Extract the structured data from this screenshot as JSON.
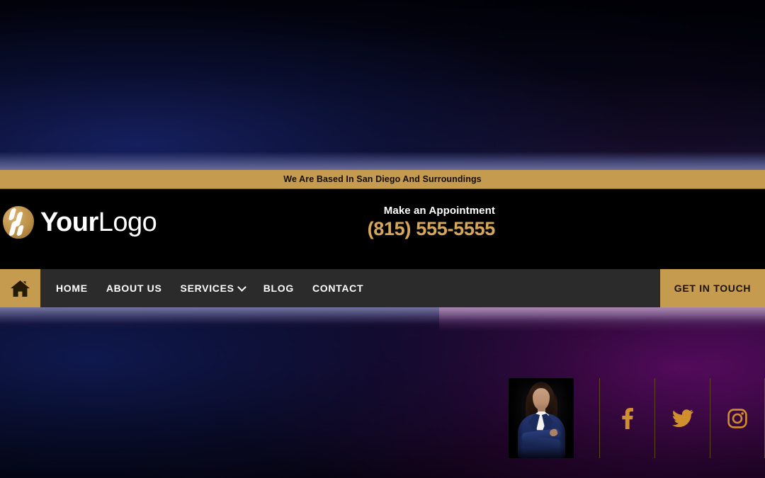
{
  "colors": {
    "gold": "#c59b50",
    "gold_text": "#d7a759",
    "nav_bg": "#2b2b2b",
    "header_bg": "#000000",
    "announce_text": "#140d02",
    "nav_text": "#ffffff",
    "cta_text": "#1a1206",
    "divider": "#5c4620"
  },
  "announcement": {
    "text": "We Are Based In San Diego And Surroundings"
  },
  "header": {
    "logo": {
      "icon": "shield-stripes-logo-icon",
      "name_bold": "Your",
      "name_light": "Logo"
    },
    "appointment": {
      "label": "Make an Appointment",
      "phone": "(815) 555-5555"
    },
    "person_photo": {
      "alt": "businesswoman-portrait"
    },
    "socials": [
      {
        "name": "facebook",
        "icon": "facebook-icon"
      },
      {
        "name": "twitter",
        "icon": "twitter-icon"
      },
      {
        "name": "instagram",
        "icon": "instagram-icon"
      }
    ]
  },
  "nav": {
    "home_icon": "home-icon",
    "items": [
      {
        "label": "HOME",
        "has_dropdown": false
      },
      {
        "label": "ABOUT US",
        "has_dropdown": false
      },
      {
        "label": "SERVICES",
        "has_dropdown": true
      },
      {
        "label": "BLOG",
        "has_dropdown": false
      },
      {
        "label": "CONTACT",
        "has_dropdown": false
      }
    ],
    "cta_label": "GET IN TOUCH"
  }
}
